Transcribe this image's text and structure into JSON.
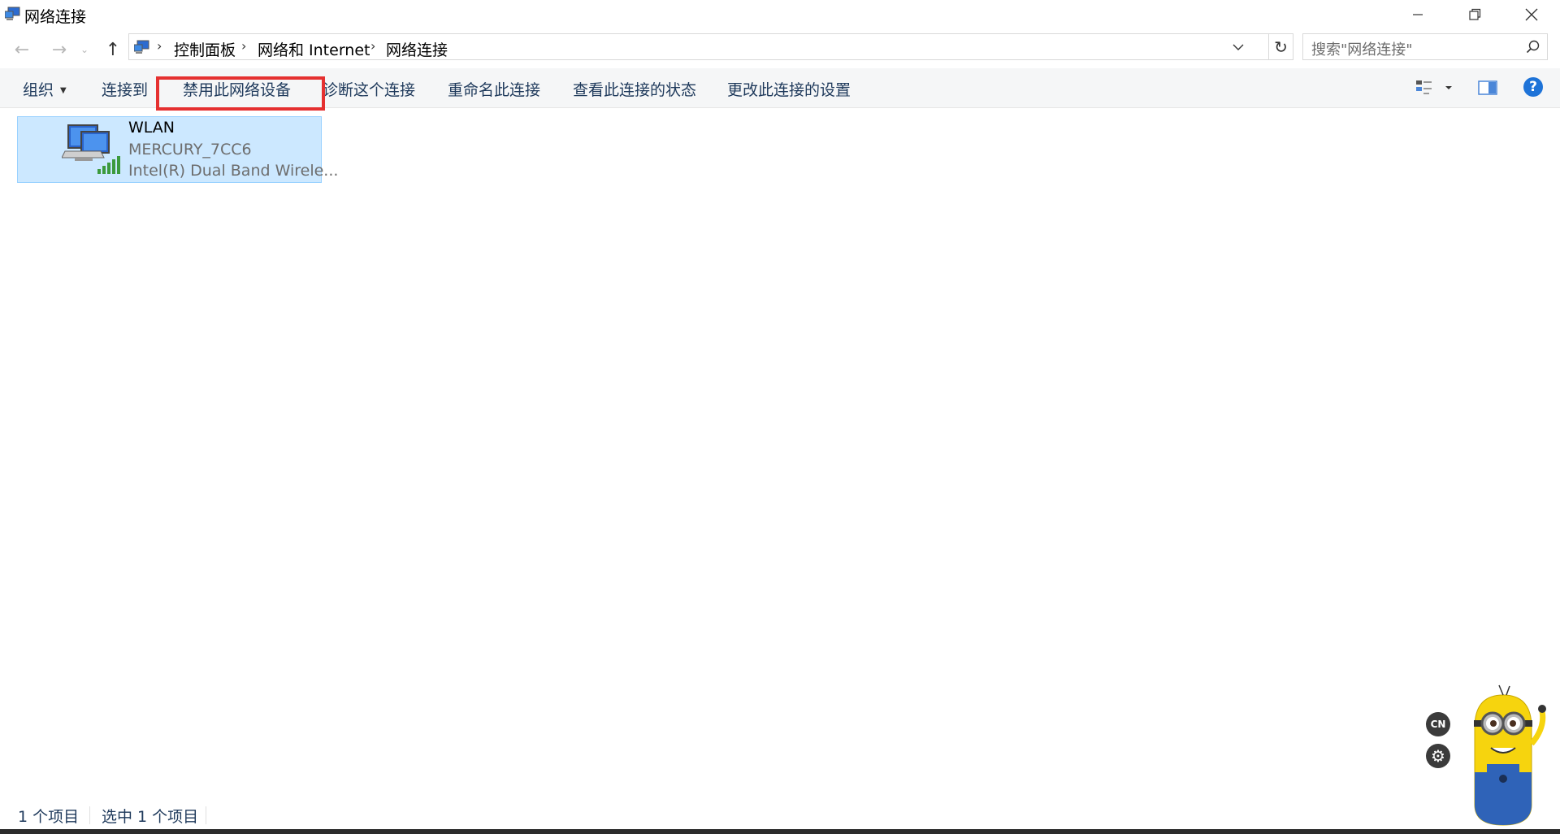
{
  "window": {
    "title": "网络连接",
    "icon": "network-connections-icon",
    "controls": [
      "minimize-icon",
      "restore-icon",
      "close-icon"
    ]
  },
  "navigation": {
    "back_icon": "arrow-left-icon",
    "forward_icon": "arrow-right-icon",
    "recent_icon": "chevron-down-icon",
    "up_icon": "arrow-up-icon"
  },
  "address": {
    "breadcrumbs": [
      "控制面板",
      "网络和 Internet",
      "网络连接"
    ],
    "refresh_icon": "refresh-icon"
  },
  "search": {
    "placeholder": "搜索\"网络连接\""
  },
  "toolbar": {
    "organize": "组织",
    "connect_to": "连接到",
    "disable_device": "禁用此网络设备",
    "diagnose": "诊断这个连接",
    "rename": "重命名此连接",
    "view_status": "查看此连接的状态",
    "change_settings": "更改此连接的设置"
  },
  "items": [
    {
      "name": "WLAN",
      "network": "MERCURY_7CC6",
      "adapter": "Intel(R) Dual Band Wirele...",
      "icon": "wireless-network-adapter-icon",
      "selected": true
    }
  ],
  "statusbar": {
    "item_count": "1 个项目",
    "selected_count": "选中 1 个项目"
  },
  "widget": {
    "lang_label": "CN",
    "settings_icon": "gear-icon",
    "mascot": "minion-mascot"
  },
  "colors": {
    "selection_bg": "#cce8ff",
    "highlight_border": "#e53030",
    "command_text": "#1e395b",
    "help_blue": "#1e73d8"
  }
}
